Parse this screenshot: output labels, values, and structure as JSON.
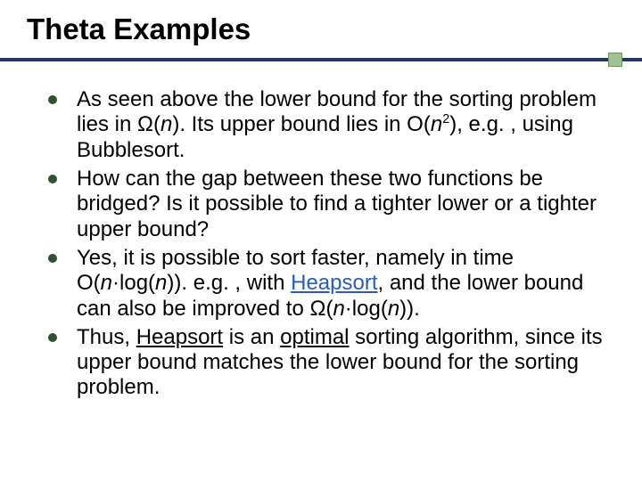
{
  "title": "Theta Examples",
  "bullets": {
    "b1": {
      "t0": "As seen above the lower bound for the sorting problem lies in ",
      "omega_n": "Ω",
      "open1": "(",
      "n1": "n",
      "close1": ").",
      "t1": " Its upper bound lies in O(",
      "n2": "n",
      "sup2": "2",
      "t2": "), e.g. , using Bubblesort."
    },
    "b2": "How can the gap between these two functions be bridged? Is it possible to find a tighter lower or a tighter upper bound?",
    "b3": {
      "t0": "Yes, it is possible to sort faster, namely in time O(",
      "n1": "n",
      "t1": "·log(",
      "n2": "n",
      "t2": ")). e.g. , with ",
      "heapsort": "Heapsort",
      "t3": ", and the lower bound can also be improved to ",
      "omega": "Ω",
      "open2": "(",
      "n3": "n",
      "t4": "·log(",
      "n4": "n",
      "t5": "))."
    },
    "b4": {
      "t0": "Thus, ",
      "heapsort": "Heapsort",
      "t1": " is an ",
      "optimal": "optimal",
      "t2": " sorting algorithm, since its upper bound matches the lower bound for the sorting problem."
    }
  }
}
